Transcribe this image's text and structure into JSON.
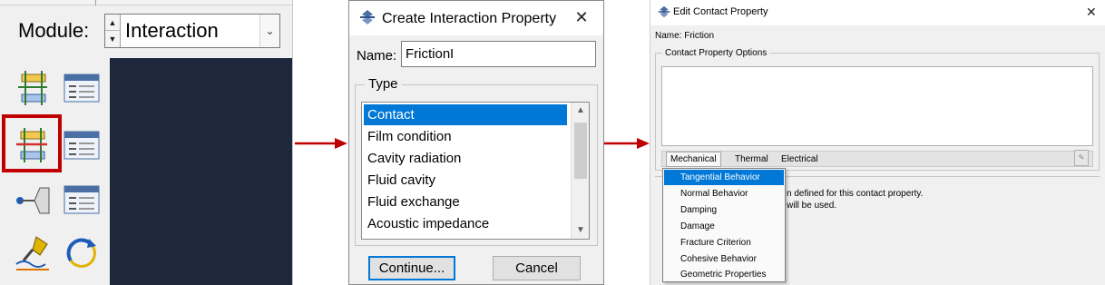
{
  "panel1": {
    "module_label": "Module:",
    "module_value": "Interaction",
    "tools": [
      {
        "name": "create-interaction-icon"
      },
      {
        "name": "interaction-manager-icon"
      },
      {
        "name": "create-interaction-property-icon",
        "highlighted": true
      },
      {
        "name": "interaction-property-manager-icon"
      },
      {
        "name": "create-constraint-icon"
      },
      {
        "name": "constraint-manager-icon"
      },
      {
        "name": "create-connector-icon"
      },
      {
        "name": "create-wire-icon"
      }
    ],
    "highlight_color": "#c00000",
    "viewport_color": "#1d283c"
  },
  "arrow_color": "#c00000",
  "panel2": {
    "title": "Create Interaction Property",
    "name_label": "Name:",
    "name_value": "Friction",
    "type_label": "Type",
    "types": [
      "Contact",
      "Film condition",
      "Cavity radiation",
      "Fluid cavity",
      "Fluid exchange",
      "Acoustic impedance"
    ],
    "selected_type": "Contact",
    "continue_label": "Continue...",
    "cancel_label": "Cancel"
  },
  "panel3": {
    "title": "Edit Contact Property",
    "name_line": "Name:  Friction",
    "options_label": "Contact Property Options",
    "menus": [
      "Mechanical",
      "Thermal",
      "Electrical"
    ],
    "mechanical_items": [
      "Tangential Behavior",
      "Normal Behavior",
      "Damping",
      "Damage",
      "Fracture Criterion",
      "Cohesive Behavior",
      "Geometric Properties"
    ],
    "hovered_item": "Tangential Behavior",
    "status_line_1": "n defined for this contact property.",
    "status_line_2": "will be used.",
    "accent_color": "#0078d7"
  }
}
